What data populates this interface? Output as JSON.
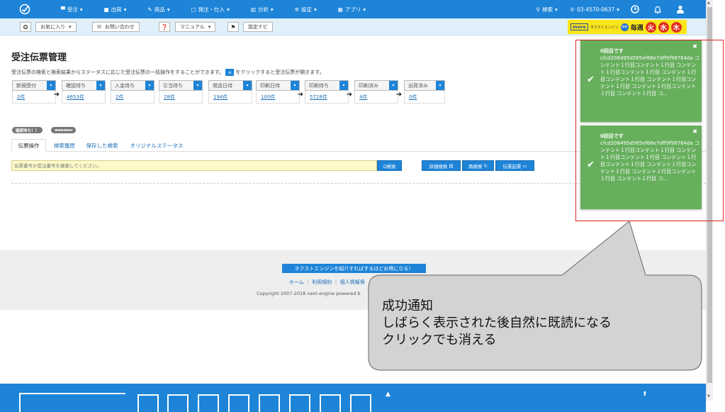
{
  "nav": {
    "items": [
      {
        "label": "受注",
        "icon": "cart-icon"
      },
      {
        "label": "出荷",
        "icon": "truck-icon"
      },
      {
        "label": "商品",
        "icon": "pencil-icon"
      },
      {
        "label": "発注・仕入",
        "icon": "box-icon"
      },
      {
        "label": "分析",
        "icon": "chart-icon"
      },
      {
        "label": "設定",
        "icon": "gear-icon"
      },
      {
        "label": "アプリ",
        "icon": "grid-icon"
      }
    ],
    "search_label": "検索",
    "phone": "03-4570-0637"
  },
  "subbar": {
    "favorite": "お気に入り",
    "contact": "お問い合わせ",
    "manual": "マニュアル",
    "setup_nav": "設定ナビ"
  },
  "banner": {
    "more": "more",
    "ne": "ネクストエンジン",
    "badge": "開催",
    "weekly": "毎週",
    "days": [
      "火",
      "水",
      "木"
    ]
  },
  "page": {
    "title": "受注伝票管理",
    "desc_before": "受注伝票の検索と検索結果からステータスに応じた受注伝票の一括操作をすることができます。",
    "desc_after": "をクリックすると受注伝票が開きます。"
  },
  "statuses": [
    {
      "label": "新規受付",
      "count": "2件"
    },
    {
      "label": "確認待ち",
      "count": "4653件"
    },
    {
      "label": "入金待ち",
      "count": "2件"
    },
    {
      "label": "引当待ち",
      "count": "28件"
    },
    {
      "label": "発送日待",
      "count": "194件"
    },
    {
      "label": "印刷日待",
      "count": "100件"
    },
    {
      "label": "印刷待ち",
      "count": "5728件"
    },
    {
      "label": "印刷済み",
      "count": "4件"
    },
    {
      "label": "出荷済み",
      "count": "0件"
    }
  ],
  "chips": [
    "確認待ち！！",
    "wauwau"
  ],
  "tabs": [
    "伝票操作",
    "検索履歴",
    "保存した検索",
    "オリジナルステータス"
  ],
  "search": {
    "placeholder": "伝票番号か受注番号を検索してください。",
    "search_btn": "Q検索",
    "detail_btn": "詳細検索",
    "research_btn": "再検索",
    "slip_btn": "伝票起票"
  },
  "footer": {
    "refer": "ネクストエンジンを紹介すればするほどお得になる！",
    "links": "ホーム ｜ 利用規約 ｜ 個人情報保",
    "copyright": "Copyright 2007-2018 next-engine powered b"
  },
  "toasts": [
    {
      "title": "0回目です",
      "body": "cfcd208495d565ef66e7dff9f98764da コンテント１行目コンテント１行目 コンテント１行目コンテント１行目 コンテント１行目コンテント１行目 コンテント１行目コンテント１行目 コンテント１行目コンテント１行目 コンテント１行目 コ..."
    },
    {
      "title": "0回目です",
      "body": "cfcd208495d565ef66e7dff9f98764da コンテント１行目コンテント１行目 コンテント１行目コンテント１行目 コンテント１行目コンテント１行目 コンテント１行目コンテント１行目 コンテント１行目コンテント１行目 コンテント１行目 コ..."
    }
  ],
  "callout": {
    "line1": "成功通知",
    "line2": "しばらく表示された後自然に既読になる",
    "line3": "クリックでも消える"
  }
}
